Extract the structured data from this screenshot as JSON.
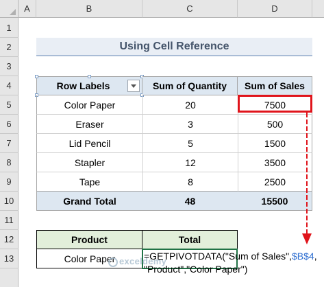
{
  "sheet": {
    "columns": [
      "A",
      "B",
      "C",
      "D"
    ],
    "rows": [
      "1",
      "2",
      "3",
      "4",
      "5",
      "6",
      "7",
      "8",
      "9",
      "10",
      "11",
      "12",
      "13"
    ]
  },
  "title": "Using Cell Reference",
  "pivot": {
    "headers": [
      "Row Labels",
      "Sum of Quantity",
      "Sum of Sales"
    ],
    "rows": [
      [
        "Color Paper",
        "20",
        "7500"
      ],
      [
        "Eraser",
        "3",
        "500"
      ],
      [
        "Lid Pencil",
        "5",
        "1500"
      ],
      [
        "Stapler",
        "12",
        "3500"
      ],
      [
        "Tape",
        "8",
        "2500"
      ]
    ],
    "total": [
      "Grand Total",
      "48",
      "15500"
    ]
  },
  "lookup": {
    "headers": [
      "Product",
      "Total"
    ],
    "product": "Color Paper",
    "formula_part1": "=GETPIVOTDATA(\"Sum of Sales\",",
    "formula_ref": "$B$4",
    "formula_part2": ",",
    "formula_line2": "\"Product\",\"Color Paper\")"
  },
  "colors": {
    "highlight": "#e0141b",
    "ref_blue": "#2f6fd1",
    "header_fill": "#dde7f1",
    "lookup_header_fill": "#e2efda"
  },
  "watermark": "exceldemy"
}
